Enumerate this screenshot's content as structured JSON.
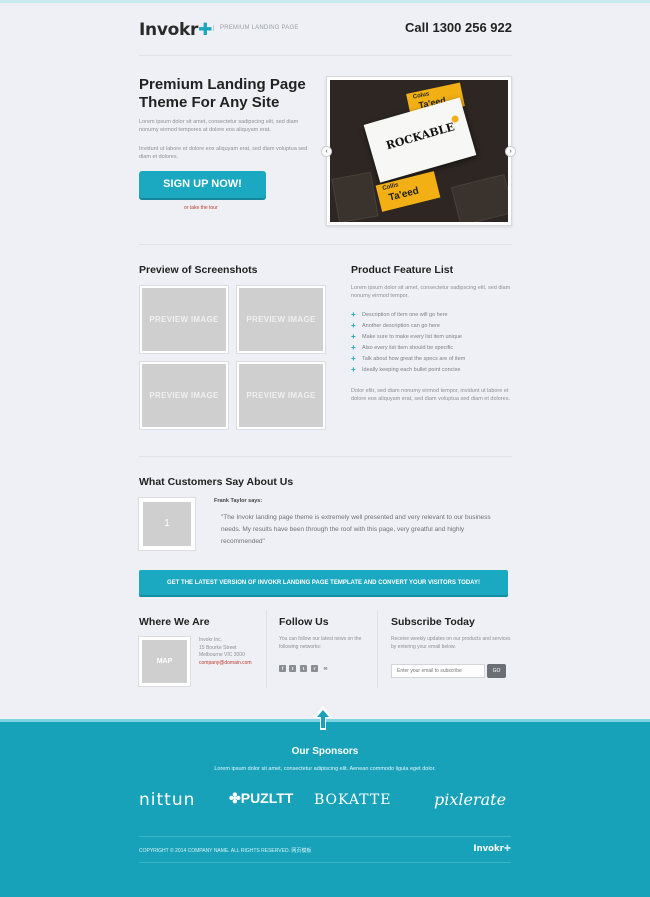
{
  "header": {
    "logo": "Invokr",
    "logo_mark": "✚",
    "tagline": "PREMIUM LANDING PAGE",
    "phone": "Call 1300 256 922"
  },
  "hero": {
    "title": "Premium Landing Page Theme For Any Site",
    "para1": "Lorem ipsum dolor sit amet, consectetur sadipscing elit, sed diam nonumy eirmod tempores at dolore eos aliquyam erat.",
    "para2": "Invidunt ut labore et dolore eos aliquyam erat, sed diam voluptua sed diam et dolores.",
    "signup_label": "SIGN UP NOW!",
    "tour_link": "or take the tour",
    "slide": {
      "card1_name": "Colus",
      "card1_brand": "Ta'eed",
      "card_main": "ROCKABLE",
      "card2_name": "Collis",
      "card2_brand": "Ta'eed",
      "prev_icon": "chevron-left-icon",
      "next_icon": "chevron-right-icon"
    }
  },
  "preview": {
    "title": "Preview of Screenshots",
    "thumbs": [
      "PREVIEW IMAGE",
      "PREVIEW IMAGE",
      "PREVIEW IMAGE",
      "PREVIEW IMAGE"
    ]
  },
  "features": {
    "title": "Product Feature List",
    "intro": "Lorem ipsum dolor sit amet, consectetur sadipscing elit, sed diam nonumy eirmod tempor.",
    "items": [
      "Description of item one will go here",
      "Another description can go here",
      "Make sure to make every list item unique",
      "Also every list item should be specific",
      "Talk about how great the specs are of item",
      "Ideally keeping each bullet point concise"
    ],
    "outro": "Dolor elitr, sed diam nonumy eirmod tempor, invidunt ut labore et dolore eos aliquyam erat, sed diam voluptua sed diam et dolores.",
    "bullet_icon": "plus-icon"
  },
  "testimonial": {
    "title": "What Customers Say About Us",
    "avatar": "1",
    "name": "Frank Taylor says:",
    "quote": "\"The Invokr landing page theme is extremely well presented and very relevant to our business needs. My results have been through the roof with this page, very greatful and highly recommended\""
  },
  "cta": {
    "label": "GET THE LATEST VERSION OF INVOKR LANDING PAGE TEMPLATE AND CONVERT YOUR VISITORS TODAY!"
  },
  "where": {
    "title": "Where We Are",
    "map": "MAP",
    "company": "Invokr Inc.",
    "street": "15 Bourke Street",
    "city": "Melbourne VIC 3000",
    "email": "company@domain.com"
  },
  "follow": {
    "title": "Follow Us",
    "text": "You can follow our latest news on the following networks:",
    "icons": [
      "f",
      "t",
      "t",
      "r",
      "✉"
    ]
  },
  "subscribe": {
    "title": "Subscribe Today",
    "text": "Receive weekly updates on our products and services by entering your email below.",
    "placeholder": "Enter your email to subscribe",
    "go_label": "GO"
  },
  "footer": {
    "sponsors_title": "Our Sponsors",
    "sponsors_text": "Lorem ipsum dolor sit amet, consectetur adipiscing elit. Aenean commodo ligula eget dolor.",
    "sponsors": [
      "nittun",
      "PUZLTT",
      "BOKATTE",
      "pixlerate"
    ],
    "copyright": "COPYRIGHT © 2014 COMPANY NAME. ALL RIGHTS RESERVED. 网页模板",
    "logo": "Invokr",
    "logo_mark": "✚"
  },
  "colors": {
    "accent": "#1ba8c1",
    "footer_bg": "#17a2ba",
    "page_bg": "#eef0f5",
    "link_red": "#c0392b"
  }
}
